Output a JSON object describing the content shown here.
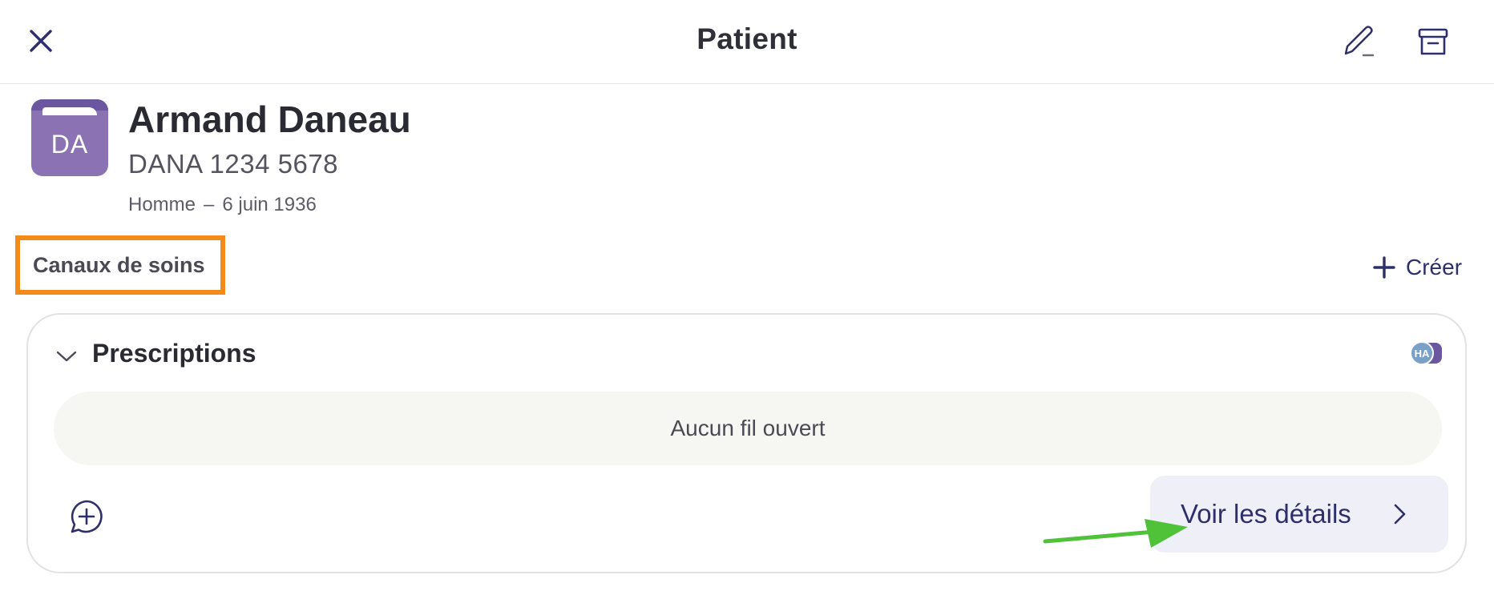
{
  "header": {
    "title": "Patient",
    "close_icon": "close-icon",
    "edit_icon": "pencil-icon",
    "archive_icon": "archive-icon"
  },
  "patient": {
    "initials": "DA",
    "name": "Armand Daneau",
    "id": "DANA 1234 5678",
    "sex": "Homme",
    "separator": "–",
    "birthdate": "6 juin 1936"
  },
  "care_channels": {
    "title": "Canaux de soins",
    "create_label": "Créer"
  },
  "card": {
    "title": "Prescriptions",
    "participant_initials": "HA",
    "empty_message": "Aucun fil ouvert",
    "details_label": "Voir les détails"
  },
  "colors": {
    "accent": "#2d2f6b",
    "avatar": "#8b73b3",
    "highlight_box": "#f28b1c",
    "annotation_arrow": "#4fc23a"
  }
}
